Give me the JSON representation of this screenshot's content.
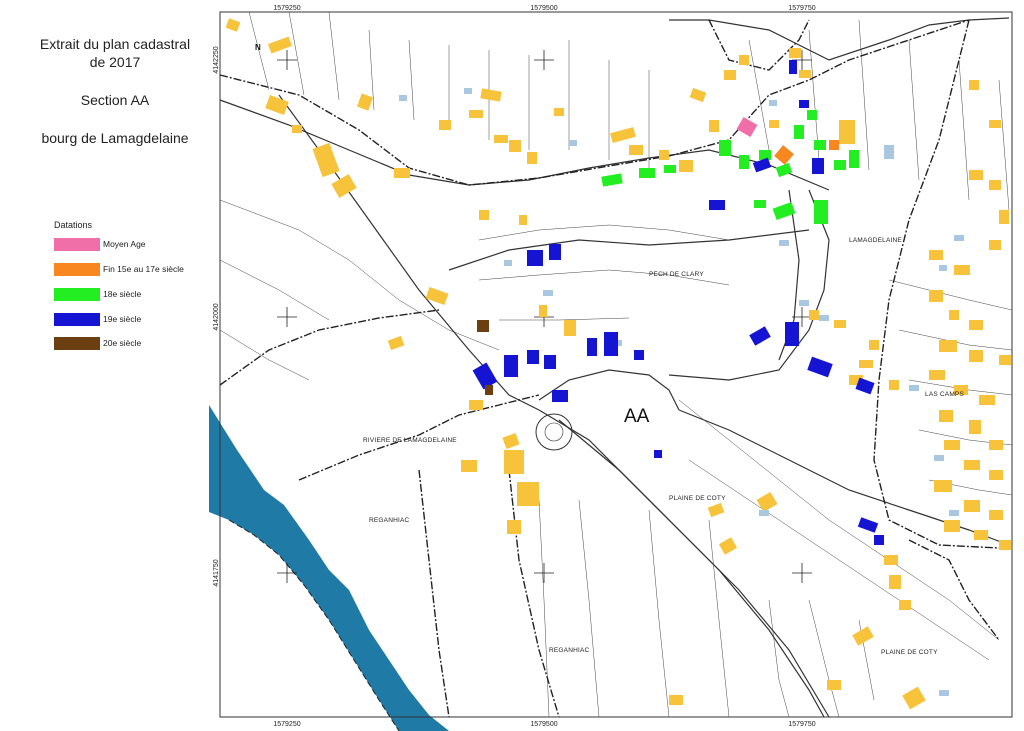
{
  "title": {
    "line1": "Extrait du plan cadastral",
    "line2": "de 2017",
    "line3": "Section AA",
    "line4": "bourg de Lamagdelaine"
  },
  "legend": {
    "title": "Datations",
    "items": [
      {
        "label": "Moyen Age",
        "color": "#f06fa8"
      },
      {
        "label": "Fin 15e au 17e siècle",
        "color": "#f7871e"
      },
      {
        "label": "18e siècle",
        "color": "#22ee22"
      },
      {
        "label": "19e siècle",
        "color": "#1414d2"
      },
      {
        "label": "20e siècle",
        "color": "#6b3f12"
      }
    ]
  },
  "map": {
    "section_label": "AA",
    "coords_top": [
      "1579250",
      "1579500",
      "1579750"
    ],
    "coords_bottom": [
      "1579250",
      "1579500",
      "1579750"
    ],
    "coords_left": [
      "4142250",
      "4142000",
      "4141750"
    ],
    "places": [
      "PECH DE CLARY",
      "LAMAGDELAINE",
      "LAS CAMPS",
      "RIVIERE DE LAMAGDELAINE",
      "REGANHIAC",
      "PLAINE DE COTY",
      "REGANHIAC",
      "PLAINE DE COTY"
    ],
    "colors": {
      "untyped_building": "#f7c33a",
      "annex_building": "#a9c7e0",
      "river": "#1f7aa6",
      "parcel_line": "#333333"
    }
  }
}
